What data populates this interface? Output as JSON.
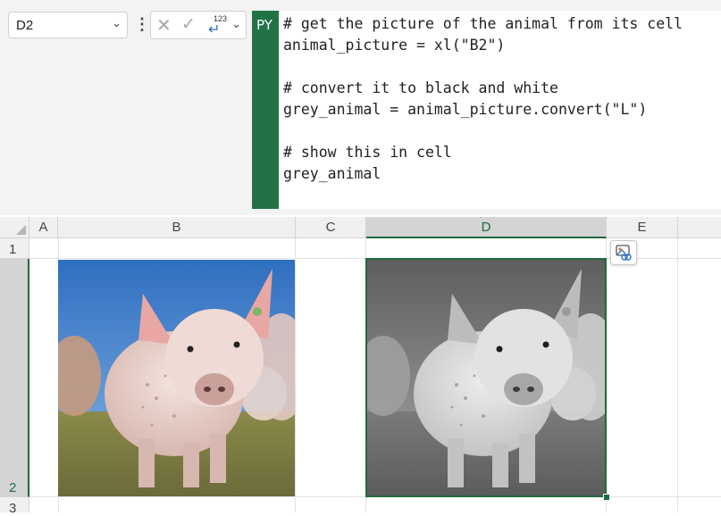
{
  "formula_bar": {
    "name_box": "D2",
    "cancel_icon": "x-icon",
    "enter_icon": "check-icon",
    "output_type": {
      "icon": "python-output-icon",
      "label": "123"
    },
    "mode_label": "PY",
    "accent_color": "#217346",
    "code_lines": [
      "# get the picture of the animal from its cell",
      "animal_picture = xl(\"B2\")",
      "",
      "# convert it to black and white",
      "grey_animal = animal_picture.convert(\"L\")",
      "",
      "# show this in cell",
      "grey_animal"
    ]
  },
  "sheet": {
    "columns": [
      "A",
      "B",
      "C",
      "D",
      "E"
    ],
    "rows": [
      "1",
      "2",
      "3"
    ],
    "selected_column": "D",
    "selected_row": "2",
    "cells": {
      "B2": {
        "type": "image",
        "description": "color photo of a pig"
      },
      "D2": {
        "type": "image",
        "description": "grayscale photo of a pig"
      }
    },
    "cell_context_icon": "picture-in-cell-icon"
  }
}
